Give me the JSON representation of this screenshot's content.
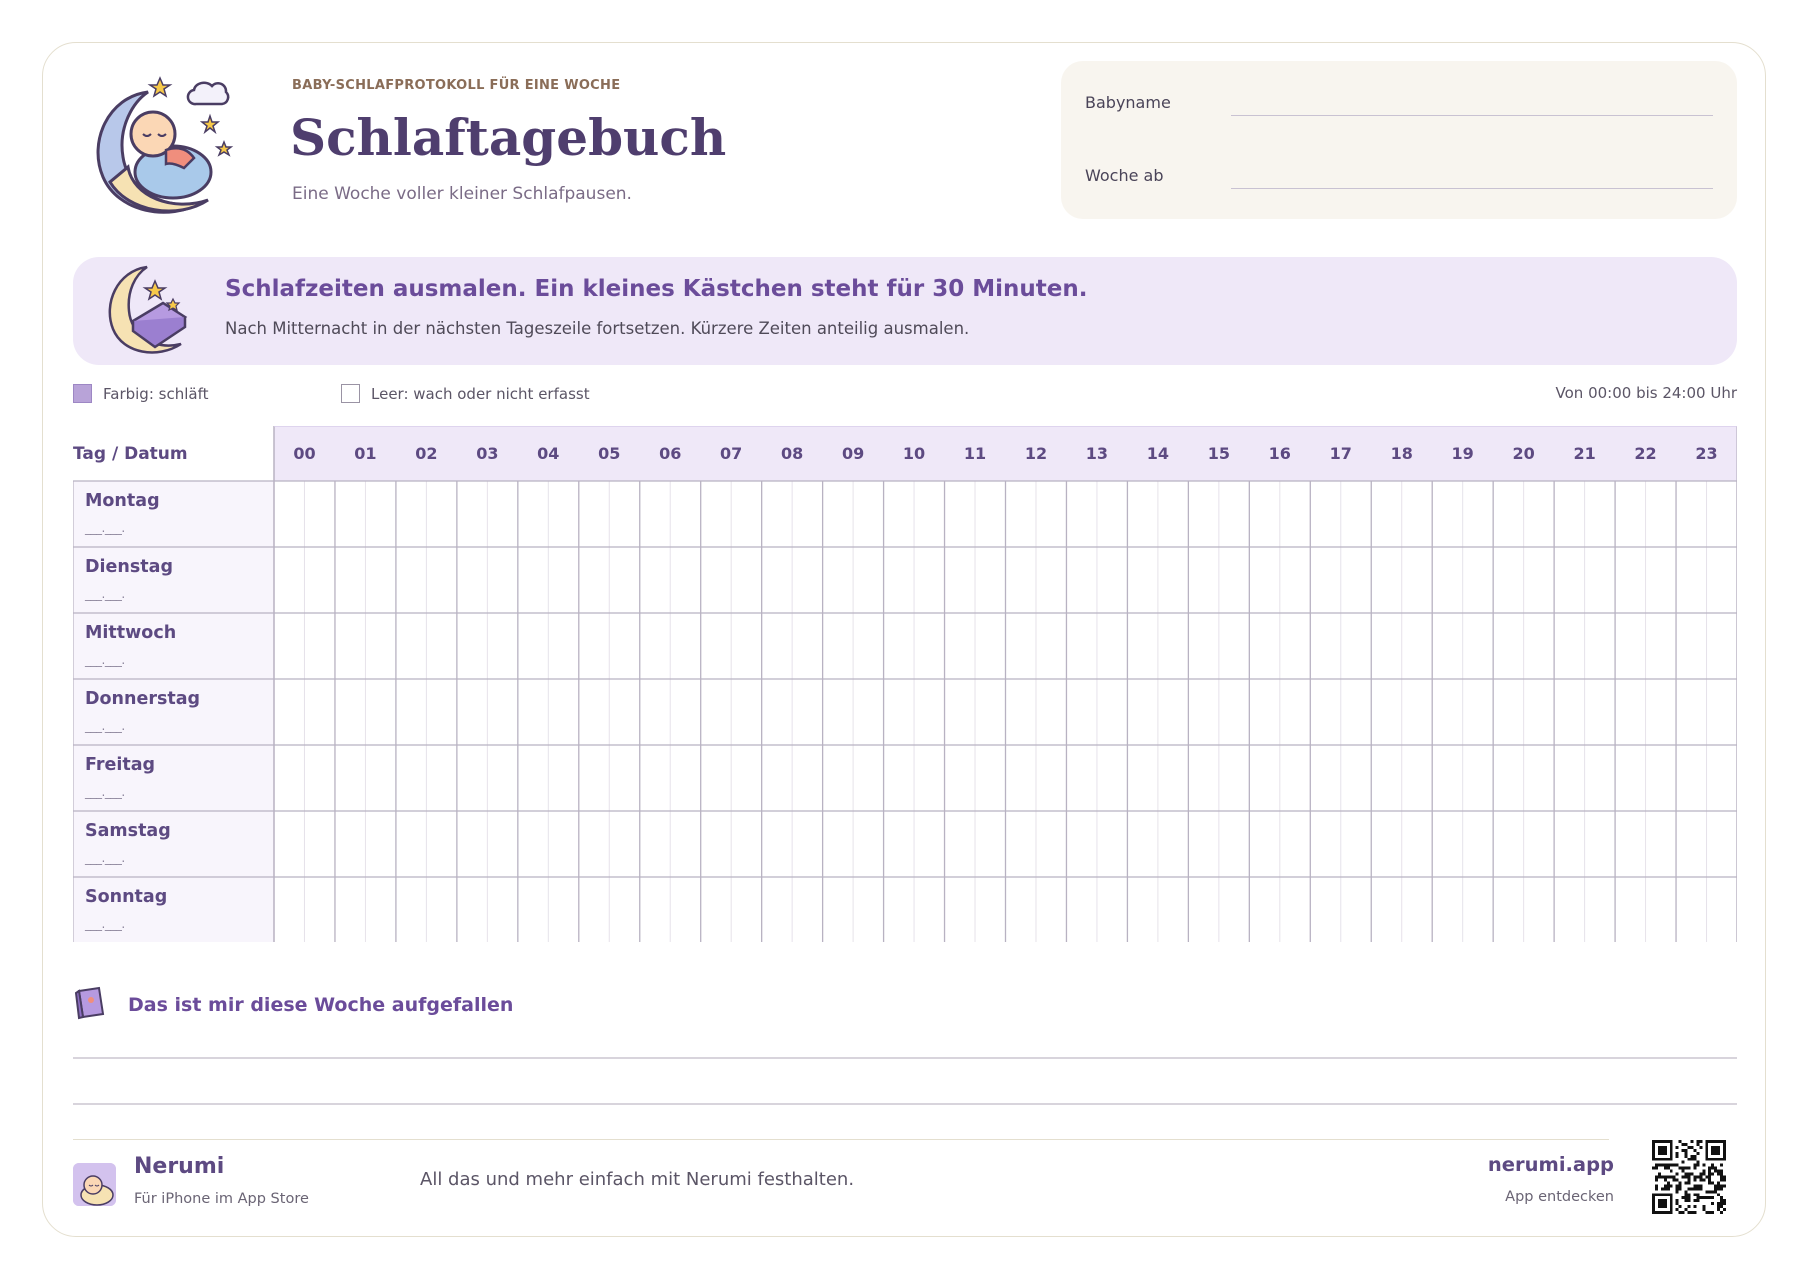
{
  "header": {
    "kicker": "BABY-SCHLAFPROTOKOLL FÜR EINE WOCHE",
    "title": "Schlaftagebuch",
    "subtitle": "Eine Woche voller kleiner Schlafpausen."
  },
  "info_fields": [
    {
      "label": "Babyname",
      "value": ""
    },
    {
      "label": "Woche ab",
      "value": ""
    }
  ],
  "banner": {
    "title": "Schlafzeiten ausmalen. Ein kleines Kästchen steht für 30 Minuten.",
    "text": "Nach Mitternacht in der nächsten Tageszeile fortsetzen. Kürzere Zeiten anteilig ausmalen."
  },
  "legend": {
    "filled": "Farbig: schläft",
    "empty": "Leer: wach oder nicht erfasst",
    "range": "Von 00:00 bis 24:00 Uhr"
  },
  "grid": {
    "corner_label": "Tag / Datum",
    "hours": [
      "00",
      "01",
      "02",
      "03",
      "04",
      "05",
      "06",
      "07",
      "08",
      "09",
      "10",
      "11",
      "12",
      "13",
      "14",
      "15",
      "16",
      "17",
      "18",
      "19",
      "20",
      "21",
      "22",
      "23"
    ],
    "days": [
      {
        "name": "Montag",
        "date": "___.___."
      },
      {
        "name": "Dienstag",
        "date": "___.___."
      },
      {
        "name": "Mittwoch",
        "date": "___.___."
      },
      {
        "name": "Donnerstag",
        "date": "___.___."
      },
      {
        "name": "Freitag",
        "date": "___.___."
      },
      {
        "name": "Samstag",
        "date": "___.___."
      },
      {
        "name": "Sonntag",
        "date": "___.___."
      }
    ],
    "colors": {
      "header_bg": "#efe8f8",
      "label_bg": "#f8f5fc",
      "hour_line": "#b8b2c2",
      "half_line": "#e6e2ea"
    }
  },
  "notes": {
    "title": "Das ist mir diese Woche aufgefallen",
    "lines": [
      "",
      ""
    ]
  },
  "footer": {
    "app_name": "Nerumi",
    "app_sub": "Für iPhone im App Store",
    "tagline": "All das und mehr einfach mit Nerumi festhalten.",
    "url": "nerumi.app",
    "cta": "App entdecken"
  },
  "icons": {
    "header": "baby-sleeping-on-moon-icon",
    "banner": "moon-with-blanket-icon",
    "notes": "notebook-icon",
    "app": "nerumi-app-icon",
    "qr": "qr-code-icon"
  }
}
